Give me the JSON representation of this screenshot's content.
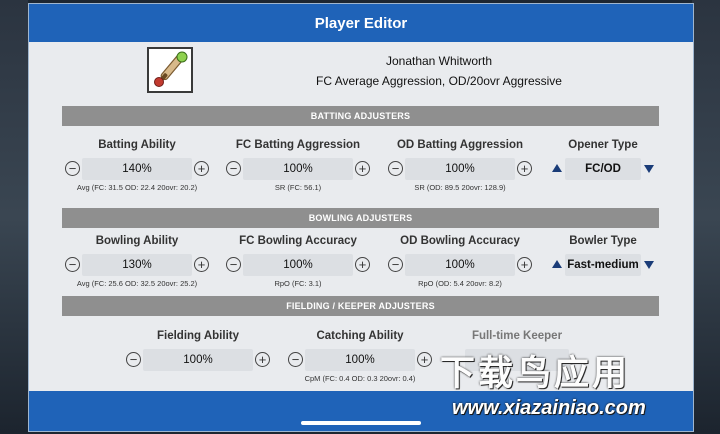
{
  "window": {
    "title": "Player Editor"
  },
  "player": {
    "name": "Jonathan Whitworth",
    "description": "FC Average Aggression, OD/20ovr Aggressive",
    "logo_icon": "cricket-bat-ball-icon"
  },
  "sections": {
    "batting": "BATTING ADJUSTERS",
    "bowling": "BOWLING ADJUSTERS",
    "fielding": "FIELDING / KEEPER ADJUSTERS"
  },
  "batting": {
    "ability": {
      "label": "Batting Ability",
      "value": "140%",
      "stat": "Avg (FC: 31.5  OD: 22.4  20ovr: 20.2)"
    },
    "fc_aggression": {
      "label": "FC Batting Aggression",
      "value": "100%",
      "stat": "SR (FC: 56.1)"
    },
    "od_aggression": {
      "label": "OD Batting Aggression",
      "value": "100%",
      "stat": "SR (OD: 89.5  20ovr: 128.9)"
    },
    "opener": {
      "label": "Opener Type",
      "value": "FC/OD"
    }
  },
  "bowling": {
    "ability": {
      "label": "Bowling Ability",
      "value": "130%",
      "stat": "Avg (FC: 25.6  OD: 32.5  20ovr: 25.2)"
    },
    "fc_accuracy": {
      "label": "FC Bowling Accuracy",
      "value": "100%",
      "stat": "RpO (FC: 3.1)"
    },
    "od_accuracy": {
      "label": "OD Bowling Accuracy",
      "value": "100%",
      "stat": "RpO (OD: 5.4  20ovr: 8.2)"
    },
    "bowler_type": {
      "label": "Bowler Type",
      "value": "Fast-medium"
    }
  },
  "fielding": {
    "ability": {
      "label": "Fielding Ability",
      "value": "100%"
    },
    "catching": {
      "label": "Catching Ability",
      "value": "100%",
      "stat": "CpM (FC: 0.4  OD: 0.3  20ovr: 0.4)"
    },
    "keeper": {
      "label": "Full-time Keeper"
    }
  },
  "controls": {
    "minus": "−",
    "plus": "+"
  },
  "watermark": {
    "text": "下载鸟应用",
    "url": "www.xiazainiao.com"
  },
  "colors": {
    "title_bar": "#1f63b8",
    "section_header": "#8f8f8f",
    "arrow": "#1a3c78"
  }
}
